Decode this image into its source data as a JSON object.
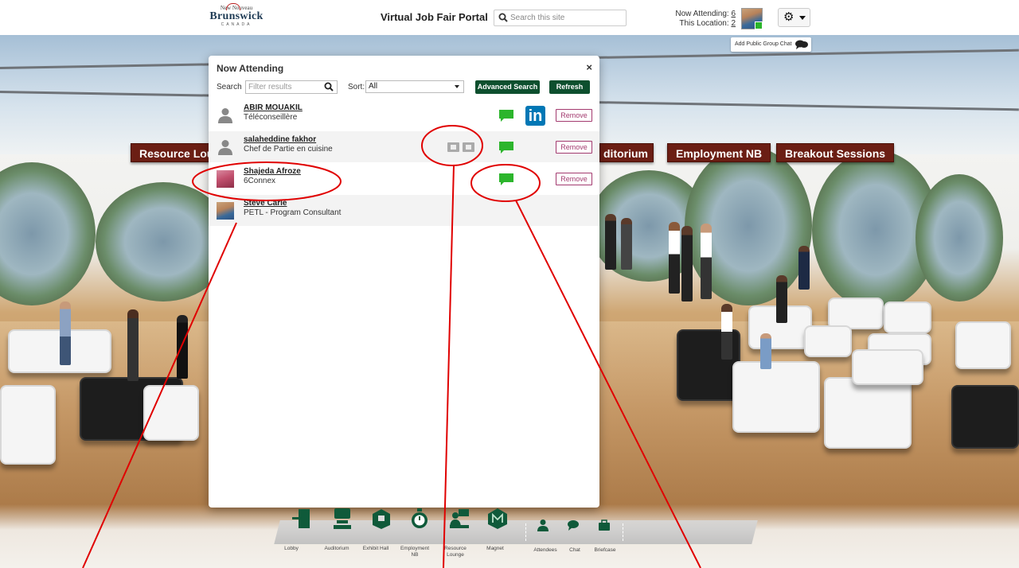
{
  "header": {
    "logo": {
      "small": "New Nouveau",
      "main": "Brunswick",
      "country": "CANADA"
    },
    "portal_title": "Virtual Job Fair Portal",
    "search_placeholder": "Search this site",
    "now_attending_label": "Now Attending:",
    "now_attending_count": "6",
    "this_location_label": "This Location:",
    "this_location_count": "2",
    "group_chat_label": "Add Public Group Chat"
  },
  "signs": [
    "Resource Lou",
    "ditorium",
    "Employment NB",
    "Breakout Sessions"
  ],
  "modal": {
    "title": "Now Attending",
    "close": "×",
    "search_label": "Search",
    "filter_placeholder": "Filter results",
    "sort_label": "Sort:",
    "sort_value": "All",
    "advanced_search": "Advanced Search",
    "refresh": "Refresh",
    "attendees": [
      {
        "name": "ABIR MOUAKIL",
        "role": "Téléconseillère",
        "chat": true,
        "linkedin": true,
        "remove": "Remove",
        "avatar": "default-avatar-icon"
      },
      {
        "name": "salaheddine fakhor",
        "role": "Chef de Partie en cuisine",
        "chat": true,
        "cards": true,
        "remove": "Remove",
        "avatar": "default-avatar-icon"
      },
      {
        "name": "Shajeda Afroze",
        "role": "6Connex",
        "chat": true,
        "remove": "Remove",
        "avatar": "photo"
      },
      {
        "name": "Steve Carle",
        "role": "PETL - Program Consultant",
        "avatar": "photo"
      }
    ]
  },
  "dock": {
    "items": [
      {
        "label": "Lobby",
        "icon": "door-icon"
      },
      {
        "label": "Auditorium",
        "icon": "podium-icon"
      },
      {
        "label": "Exhibit Hall",
        "icon": "booth-icon"
      },
      {
        "label": "Employment NB",
        "icon": "stopwatch-icon"
      },
      {
        "label": "Resource Lounge",
        "icon": "lounge-icon"
      },
      {
        "label": "Magnet",
        "icon": "magnet-logo-icon"
      }
    ],
    "secondary": [
      {
        "label": "Attendees",
        "icon": "attendees-icon"
      },
      {
        "label": "Chat",
        "icon": "chat-icon"
      },
      {
        "label": "Briefcase",
        "icon": "briefcase-icon"
      }
    ]
  },
  "colors": {
    "green_button": "#0d4f2e",
    "chat_green": "#2cb52c",
    "remove_border": "#a33a6f",
    "sign_bg": "#6b1e14",
    "linkedin": "#0077b5",
    "annotation_red": "#e00000"
  }
}
